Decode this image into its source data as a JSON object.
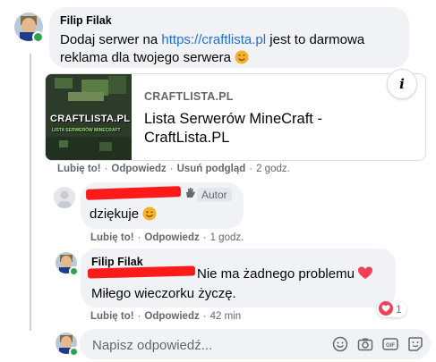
{
  "comment1": {
    "author": "Filip Filak",
    "text_before_link": "Dodaj serwer na ",
    "link": "https://craftlista.pl",
    "text_after_link": " jest to darmowa reklama dla twojego serwera",
    "emoji_icon": "smiling-face-emoji",
    "preview": {
      "domain": "CRAFTLISTA.PL",
      "title": "Lista Serwerów MineCraft - CraftLista.PL",
      "thumb_text": "CRAFTLISTA.PL",
      "thumb_subtext": "LISTA SERWERÓW MINECRAFT"
    },
    "actions": {
      "like": "Lubię to!",
      "reply": "Odpowiedz",
      "remove_preview": "Usuń podgląd",
      "time": "2 godz."
    }
  },
  "comment2": {
    "author_badge": "Autor",
    "text": "dziękuje",
    "emoji_icon": "winking-face-emoji",
    "actions": {
      "like": "Lubię to!",
      "reply": "Odpowiedz",
      "time": "1 godz."
    }
  },
  "comment3": {
    "author": "Filip Filak",
    "line1": "Nie ma żadnego problemu",
    "heart_icon": "red-heart-emoji",
    "line2": "Miłego wieczorku życzę.",
    "reaction_count": "1",
    "actions": {
      "like": "Lubię to!",
      "reply": "Odpowiedz",
      "time": "42 min"
    }
  },
  "composer": {
    "placeholder": "Napisz odpowiedź..."
  },
  "colors": {
    "link": "#216fdb",
    "bubble": "#f0f2f5",
    "online": "#31a24c",
    "heart": "#f33e58",
    "redaction": "#ff1a1a"
  }
}
